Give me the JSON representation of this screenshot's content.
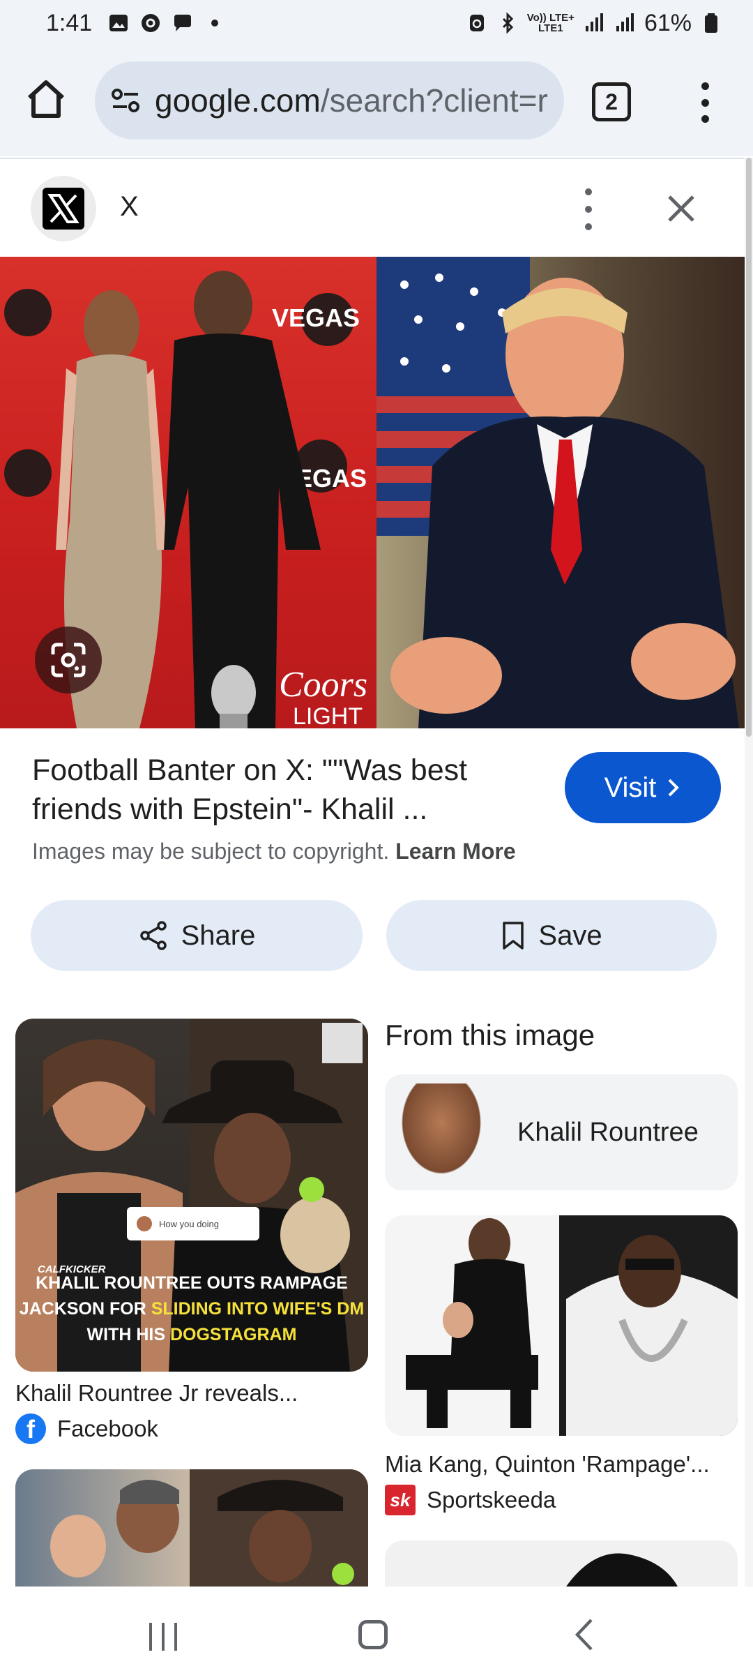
{
  "status_bar": {
    "time": "1:41",
    "network_line1": "Vo)) LTE+",
    "network_line2": "LTE1",
    "battery_percent": "61%"
  },
  "browser": {
    "url_host": "google.com",
    "url_path": "/search?client=r",
    "tab_count": "2"
  },
  "panel": {
    "source_name": "X",
    "result_title": "Football Banter on X: \"\"Was best friends with Epstein\"- Khalil ...",
    "visit_label": "Visit",
    "copyright_text": "Images may be subject to copyright.",
    "learn_more_label": "Learn More",
    "share_label": "Share",
    "save_label": "Save"
  },
  "main_image": {
    "left_signage": [
      "VEGAS",
      "Coors",
      "LIGHT"
    ]
  },
  "results": {
    "from_image_heading": "From this image",
    "entity_chip_label": "Khalil Rountree",
    "cards": [
      {
        "title": "Khalil Rountree Jr reveals...",
        "source": "Facebook",
        "image_brand": "CALFKICKER",
        "image_chat": "How you doing",
        "image_caption_line1": "KHALIL ROUNTREE OUTS RAMPAGE",
        "image_caption_line2_white": "JACKSON FOR ",
        "image_caption_line2_yellow": "SLIDING INTO WIFE'S DM",
        "image_caption_line3_white": "WITH HIS ",
        "image_caption_line3_yellow": "DOGSTAGRAM"
      },
      {
        "title": "Mia Kang, Quinton 'Rampage'...",
        "source": "Sportskeeda"
      }
    ]
  },
  "colors": {
    "accent_blue": "#0b57d0",
    "chip_bg": "#e3ebf7",
    "chrome_bg": "#f0f4f9"
  }
}
